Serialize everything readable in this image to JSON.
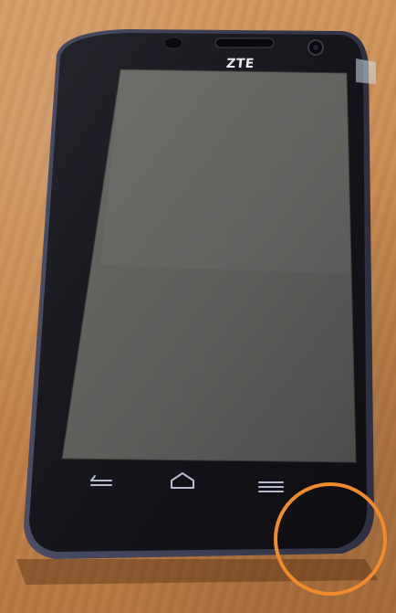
{
  "photo": {
    "brand_logo": "ZTE",
    "highlight_color": "#f08a2a",
    "nav_keys": [
      "back-icon",
      "home-icon",
      "menu-icon"
    ]
  }
}
